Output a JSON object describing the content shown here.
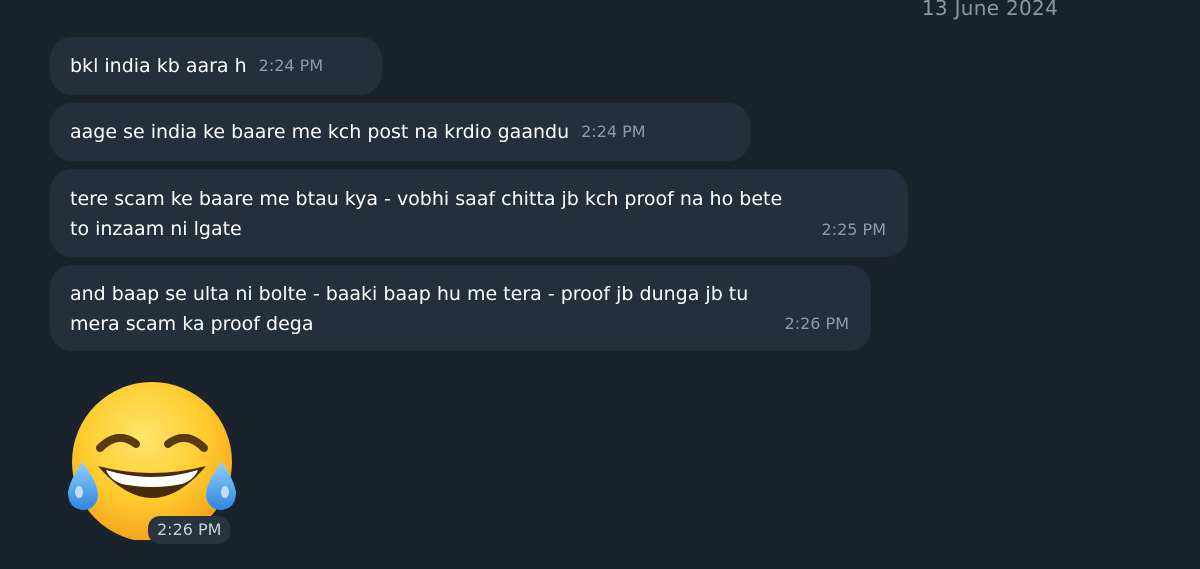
{
  "chat": {
    "date_label": "13 June 2024",
    "messages": [
      {
        "lines": [
          "bkl india kb aara h"
        ],
        "time": "2:24 PM"
      },
      {
        "lines": [
          "aage se india ke baare me kch post na krdio gaandu"
        ],
        "time": "2:24 PM"
      },
      {
        "lines": [
          "tere scam ke baare me btau kya - vobhi saaf chitta jb kch proof na ho bete",
          "to inzaam ni  lgate"
        ],
        "time": "2:25 PM"
      },
      {
        "lines": [
          "and baap se ulta ni bolte - baaki baap hu me tera - proof jb dunga jb tu",
          "mera scam ka proof dega"
        ],
        "time": "2:26 PM"
      }
    ],
    "sticker": {
      "icon": "face-with-tears-of-joy-icon",
      "time": "2:26 PM"
    }
  },
  "colors": {
    "background": "#1a222c",
    "bubble": "#232f3d",
    "text": "#ffffff",
    "timestamp": "#8e9aa8"
  }
}
